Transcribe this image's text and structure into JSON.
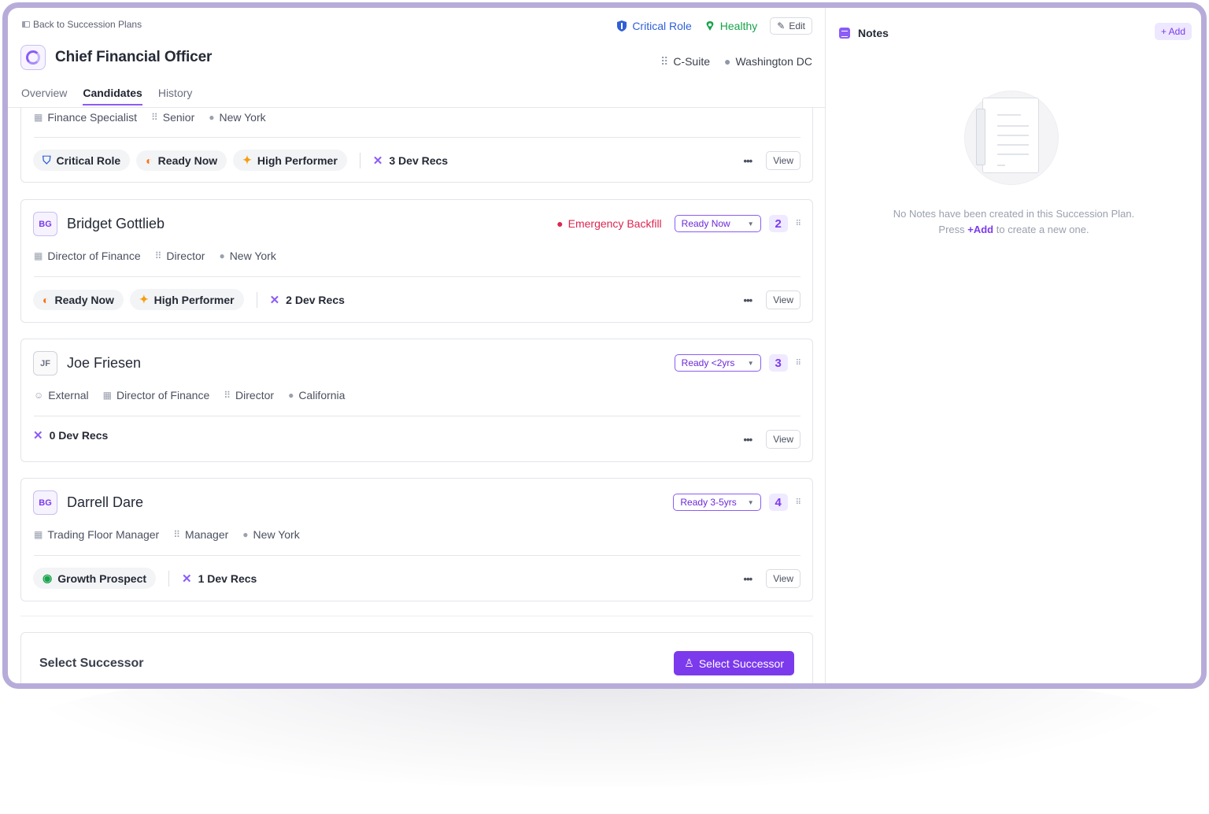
{
  "header": {
    "back_label": "Back to Succession Plans",
    "title": "Chief Financial Officer",
    "critical_label": "Critical Role",
    "healthy_label": "Healthy",
    "edit_label": "Edit",
    "level": "C-Suite",
    "location": "Washington DC"
  },
  "tabs": [
    {
      "label": "Overview",
      "active": false
    },
    {
      "label": "Candidates",
      "active": true
    },
    {
      "label": "History",
      "active": false
    }
  ],
  "candidates": [
    {
      "partial_meta": {
        "title": "Finance Specialist",
        "level": "Senior",
        "location": "New York"
      },
      "pills": [
        "Critical Role",
        "Ready Now",
        "High Performer"
      ],
      "dev_recs": "3 Dev Recs",
      "view_label": "View"
    },
    {
      "initials": "BG",
      "name": "Bridget Gottlieb",
      "flag": "Emergency Backfill",
      "readiness": "Ready Now",
      "rank": "2",
      "meta": {
        "title": "Director of Finance",
        "level": "Director",
        "location": "New York"
      },
      "pills": [
        "Ready Now",
        "High Performer"
      ],
      "dev_recs": "2 Dev Recs",
      "view_label": "View"
    },
    {
      "initials": "JF",
      "name": "Joe Friesen",
      "readiness": "Ready <2yrs",
      "rank": "3",
      "meta": {
        "type": "External",
        "title": "Director of Finance",
        "level": "Director",
        "location": "California"
      },
      "dev_recs": "0 Dev Recs",
      "view_label": "View"
    },
    {
      "initials": "BG",
      "name": "Darrell Dare",
      "readiness": "Ready 3-5yrs",
      "rank": "4",
      "meta": {
        "title": "Trading Floor Manager",
        "level": "Manager",
        "location": "New York"
      },
      "pills": [
        "Growth Prospect"
      ],
      "dev_recs": "1 Dev Recs",
      "view_label": "View"
    }
  ],
  "select_successor": {
    "title": "Select Successor",
    "button_label": "Select Successor"
  },
  "notes": {
    "title": "Notes",
    "add_label": "+ Add",
    "empty_line1": "No Notes have been created in this Succession Plan.",
    "empty_press": "Press",
    "empty_add": "+Add",
    "empty_rest": "to create a new one."
  },
  "colors": {
    "accent": "#7c3aed",
    "critical": "#2f5fd8",
    "healthy": "#16a34a",
    "emergency": "#dc2650",
    "frame": "#b7acd9"
  },
  "icons": [
    "back-icon",
    "shield-icon",
    "health-icon",
    "pencil-icon",
    "org-chart-icon",
    "pin-icon",
    "building-icon",
    "tools-icon",
    "dots-icon",
    "grip-icon",
    "notes-icon",
    "person-icon"
  ]
}
